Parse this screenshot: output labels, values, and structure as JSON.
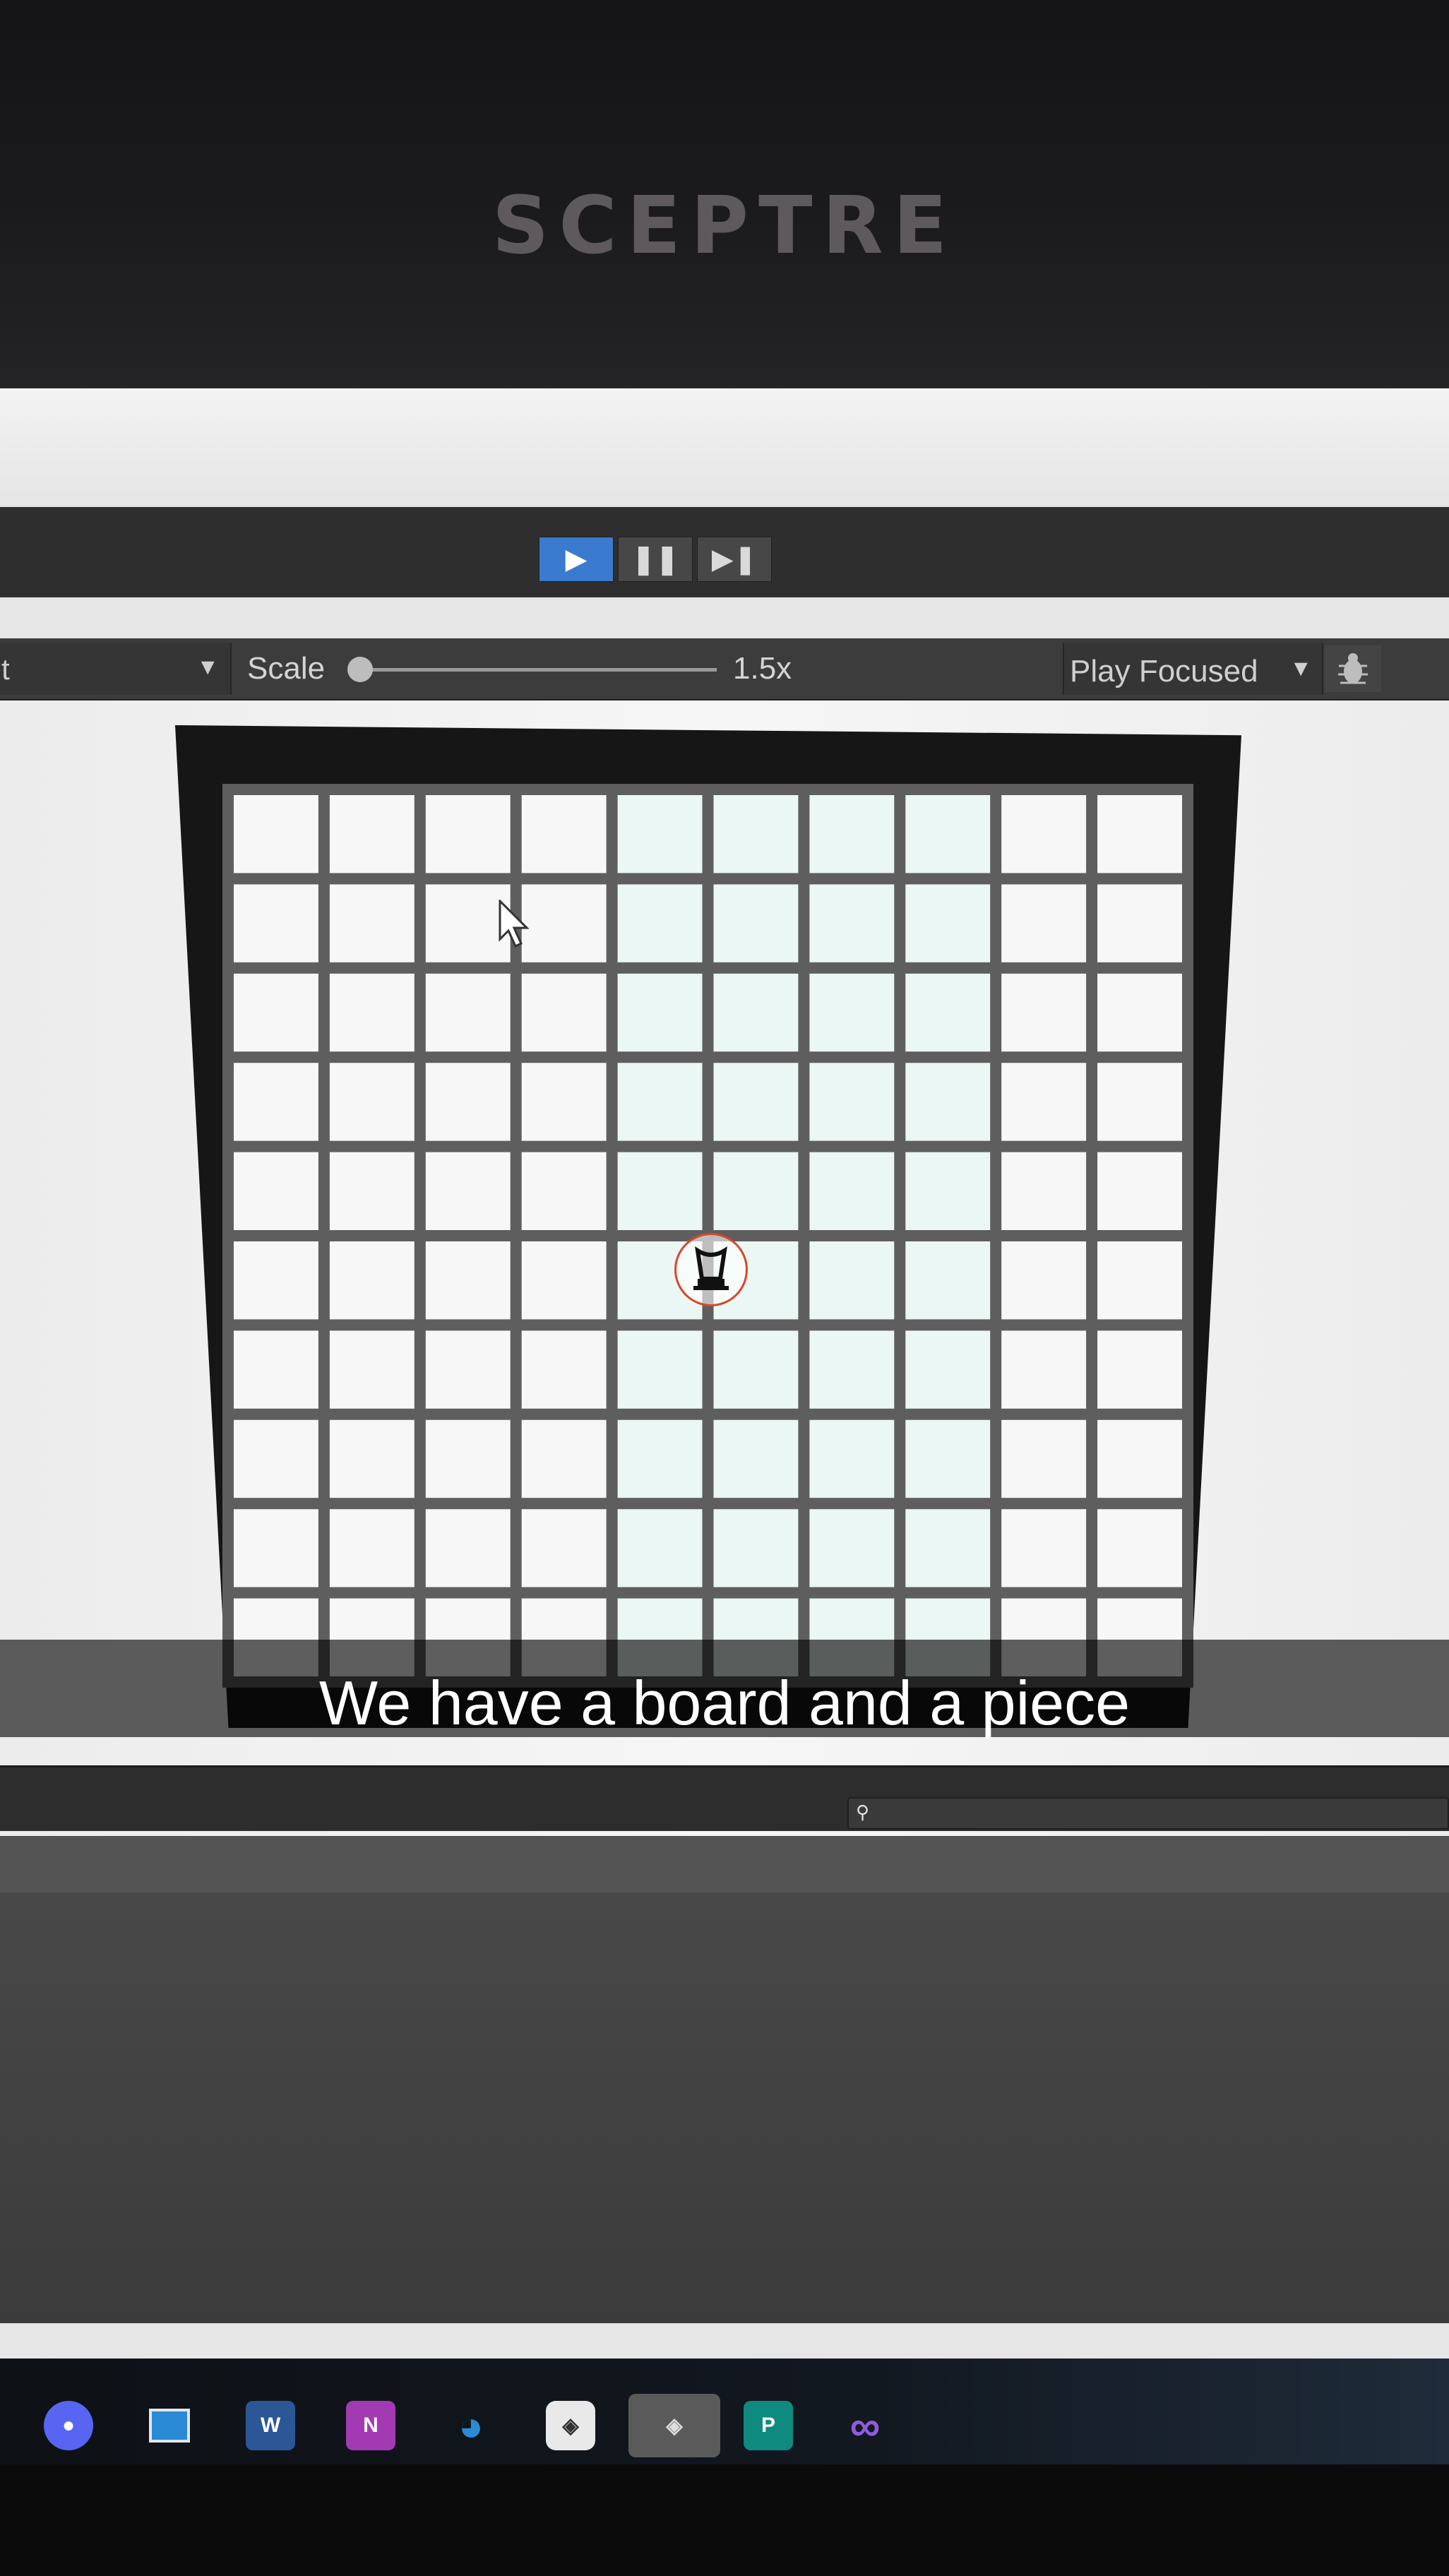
{
  "monitor": {
    "brand": "SCEPTRE"
  },
  "play_controls": {
    "play": {
      "icon": "play-icon"
    },
    "pause": {
      "icon": "pause-icon"
    },
    "step": {
      "icon": "step-icon"
    }
  },
  "game_toolbar": {
    "display_label": "t",
    "scale_label": "Scale",
    "scale_value": "1.5x",
    "play_mode": "Play Focused",
    "debug_icon": "bug-icon"
  },
  "board": {
    "columns": 10,
    "rows": 10,
    "piece_icon": "chess-piece-icon"
  },
  "taskbar": {
    "icons": [
      "discord-icon",
      "app-icon",
      "word-icon",
      "onenote-icon",
      "edge-icon",
      "unity-icon",
      "unity-hub-icon",
      "publisher-icon",
      "visual-studio-icon"
    ]
  },
  "caption": "We have a board and a piece"
}
